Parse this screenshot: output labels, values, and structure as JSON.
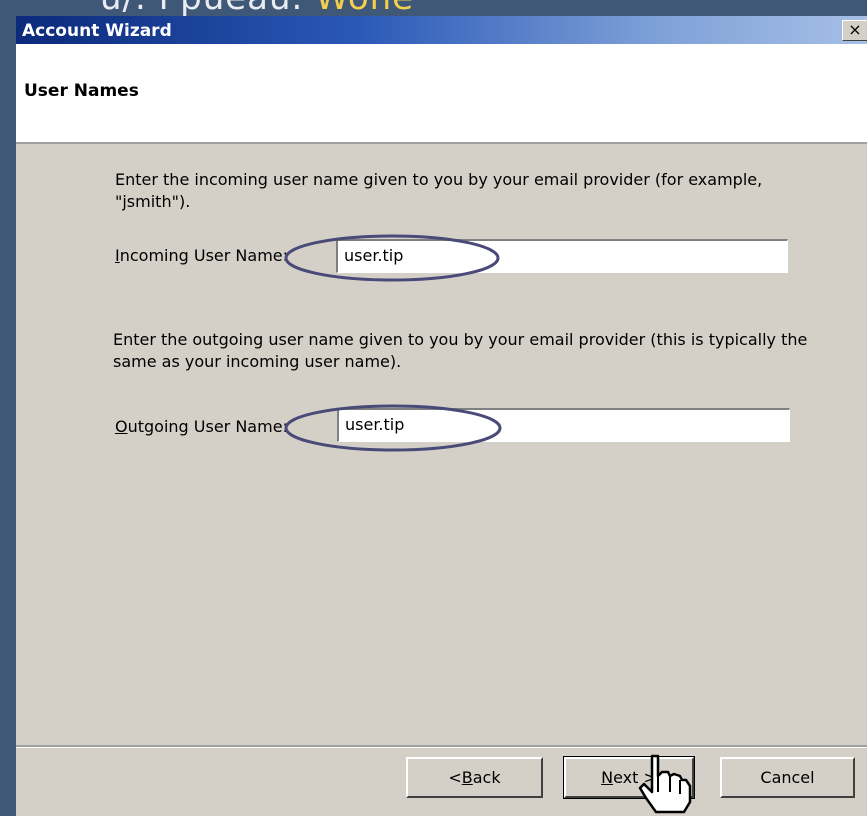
{
  "background_caption": {
    "text_prefix": "u/. Ppueau.",
    "text_accent": "Wone"
  },
  "window": {
    "title": "Account Wizard",
    "close_glyph": "×"
  },
  "header": {
    "title": "User Names"
  },
  "incoming": {
    "instruction": "Enter the incoming user name given to you by your email provider (for example, \"jsmith\").",
    "label_mnemonic": "I",
    "label_rest": "ncoming User Name:",
    "value": "user.tip"
  },
  "outgoing": {
    "instruction": "Enter the outgoing user name given to you by your email provider (this is typically the same as your incoming user name).",
    "label_mnemonic": "O",
    "label_rest": "utgoing User Name:",
    "value": "user.tip"
  },
  "buttons": {
    "back_prefix": "< ",
    "back_mnemonic": "B",
    "back_rest": "ack",
    "next_mnemonic": "N",
    "next_rest": "ext >",
    "cancel": "Cancel"
  },
  "colors": {
    "desktop": "#3f5878",
    "dialog": "#d4d0c8",
    "titlebar_start": "#0b2a7a",
    "titlebar_end": "#a6c0e6",
    "highlight_ellipse": "#4a4a78"
  },
  "icons": {
    "cursor": "hand-pointer-icon"
  }
}
